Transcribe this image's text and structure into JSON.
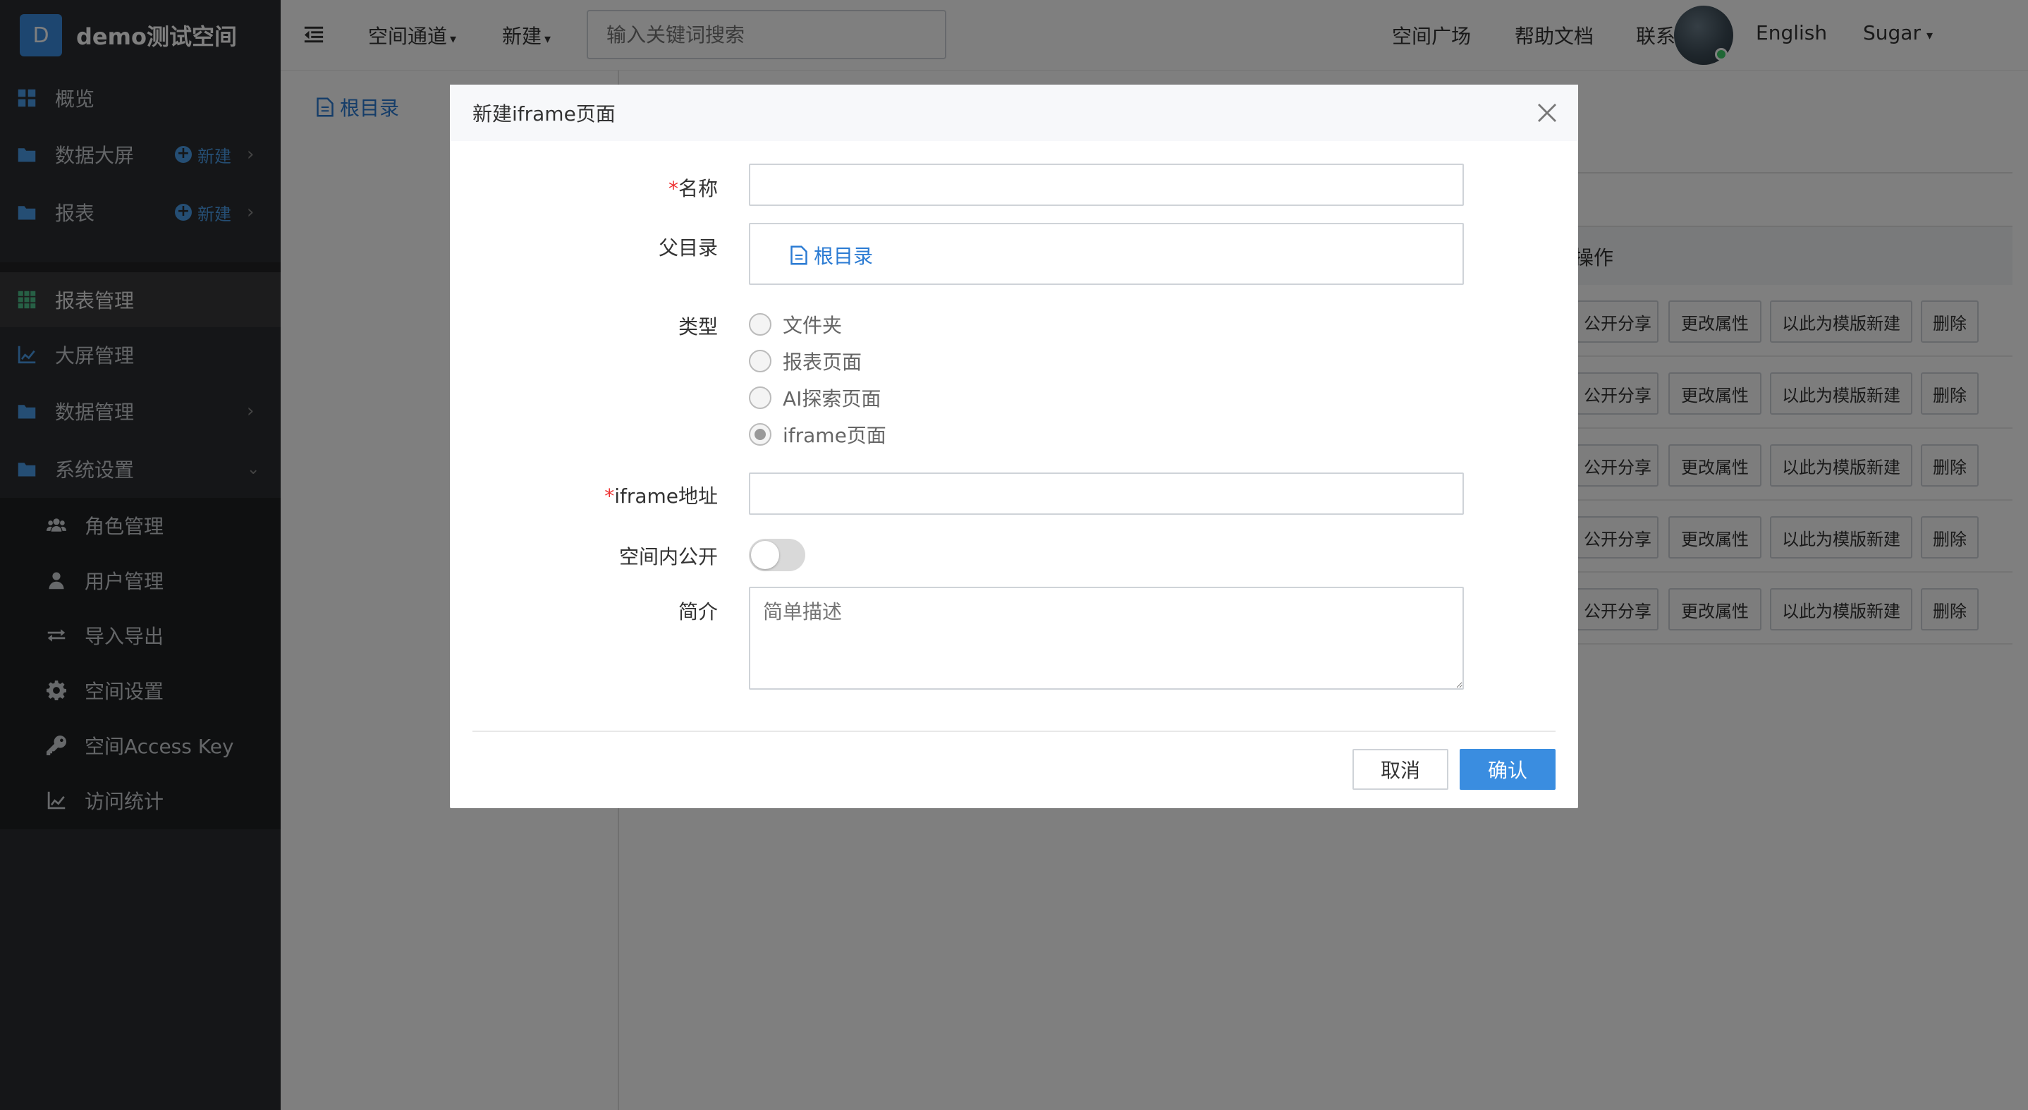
{
  "brand": {
    "logo_letter": "D",
    "title": "demo测试空间"
  },
  "sidebar": {
    "items": [
      {
        "label": "概览"
      },
      {
        "label": "数据大屏",
        "new_label": "新建"
      },
      {
        "label": "报表",
        "new_label": "新建"
      },
      {
        "label": "报表管理"
      },
      {
        "label": "大屏管理"
      },
      {
        "label": "数据管理"
      },
      {
        "label": "系统设置"
      }
    ],
    "sub_items": [
      {
        "label": "角色管理"
      },
      {
        "label": "用户管理"
      },
      {
        "label": "导入导出"
      },
      {
        "label": "空间设置"
      },
      {
        "label": "空间Access Key"
      },
      {
        "label": "访问统计"
      }
    ]
  },
  "header": {
    "nav_space": "空间通道",
    "nav_new": "新建",
    "search_placeholder": "输入关键词搜索",
    "links": [
      "空间广场",
      "帮助文档",
      "联系我们",
      "English"
    ],
    "user_name": "Sugar"
  },
  "tree": {
    "root_label": "根目录"
  },
  "table": {
    "ops_header": "操作",
    "op_buttons": [
      "公开分享",
      "更改属性",
      "以此为模版新建",
      "删除"
    ],
    "row_count": 5
  },
  "modal": {
    "title": "新建iframe页面",
    "name_label": "名称",
    "parent_label": "父目录",
    "parent_value": "根目录",
    "type_label": "类型",
    "types": [
      "文件夹",
      "报表页面",
      "AI探索页面",
      "iframe页面"
    ],
    "selected_type": "iframe页面",
    "url_label": "iframe地址",
    "public_label": "空间内公开",
    "public_on": false,
    "desc_label": "简介",
    "desc_placeholder": "简单描述",
    "cancel_label": "取消",
    "confirm_label": "确认"
  },
  "colors": {
    "accent": "#3a8de0",
    "sidebar_bg": "#2b2d30",
    "required": "#e33333"
  }
}
